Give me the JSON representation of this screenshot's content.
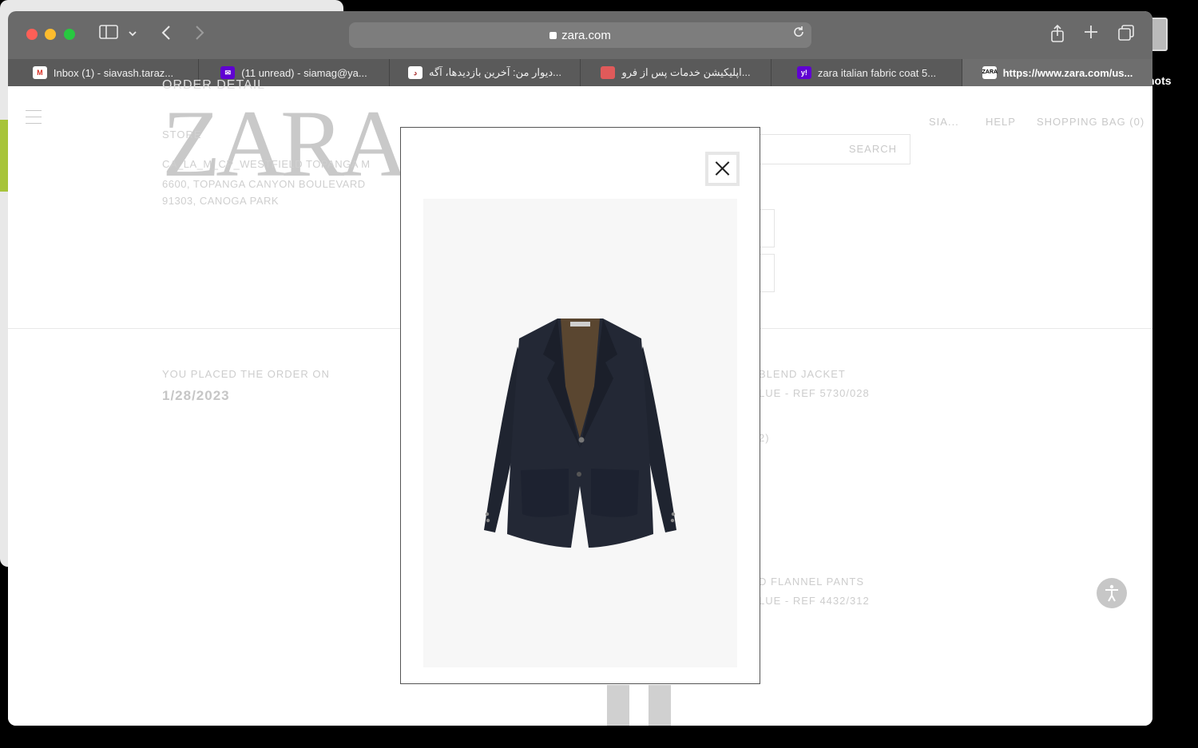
{
  "desktop": {
    "side_label": "hots"
  },
  "browser": {
    "url": "zara.com",
    "tabs": [
      {
        "favicon": "gmail-icon",
        "title": "Inbox (1) - siavash.taraz..."
      },
      {
        "favicon": "yahoo-mail-icon",
        "title": "(11 unread) - siamag@ya..."
      },
      {
        "favicon": "divar-icon",
        "title": "دیوار من: آخرین بازدیدها، آگه..."
      },
      {
        "favicon": "service-app-icon",
        "title": "اپلیکیشن خدمات پس از فرو..."
      },
      {
        "favicon": "yahoo-search-icon",
        "title": "zara italian fabric coat 5..."
      },
      {
        "favicon": "zara-icon",
        "title": "https://www.zara.com/us..."
      }
    ],
    "active_tab_index": 5
  },
  "page": {
    "order_detail_title": "ORDER DETAIL",
    "logo": "ZARA",
    "store_label": "STORE",
    "store_lines": [
      "CA_LA_M_CP_WESTFIELD TOPANGA M",
      "6600, TOPANGA CANYON BOULEVARD",
      "91303, CANOGA PARK"
    ],
    "nav": {
      "user": "SIA...",
      "help": "HELP",
      "bag": "SHOPPING BAG (0)"
    },
    "search_label": "SEARCH",
    "placed_label": "YOU PLACED THE ORDER ON",
    "placed_date": "1/28/2023",
    "items": [
      {
        "name_fragment": "BLEND JACKET",
        "ref_fragment": "LUE - REF 5730/028",
        "extra_fragment": "2)"
      },
      {
        "name_fragment": "D FLANNEL PANTS",
        "ref_fragment": "LUE - REF 4432/312"
      }
    ]
  },
  "modal": {
    "close_icon": "close-icon",
    "product_image": "navy-blazer-jacket"
  }
}
